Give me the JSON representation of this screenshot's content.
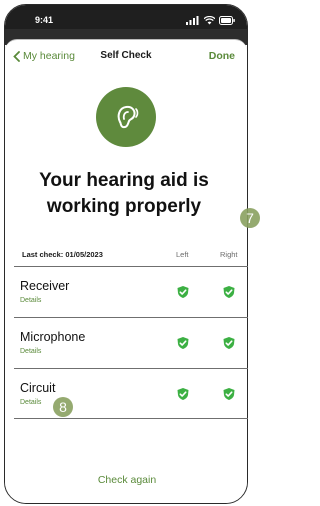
{
  "status": {
    "time": "9:41"
  },
  "nav": {
    "back_label": "My hearing",
    "title": "Self Check",
    "done_label": "Done"
  },
  "headline": {
    "line1": "Your hearing aid is",
    "line2": "working properly"
  },
  "table": {
    "last_check": "Last check: 01/05/2023",
    "col_left": "Left",
    "col_right": "Right",
    "rows": [
      {
        "name": "Receiver",
        "details": "Details",
        "left_ok": true,
        "right_ok": true
      },
      {
        "name": "Microphone",
        "details": "Details",
        "left_ok": true,
        "right_ok": true
      },
      {
        "name": "Circuit",
        "details": "Details",
        "left_ok": true,
        "right_ok": true
      }
    ]
  },
  "footer": {
    "check_again": "Check again"
  },
  "annotations": {
    "bubble1": "7",
    "bubble2": "8"
  },
  "colors": {
    "accent": "#5a8a3a",
    "hero": "#5f8a3d",
    "shield": "#3cb043",
    "bubble": "#8aa161"
  }
}
